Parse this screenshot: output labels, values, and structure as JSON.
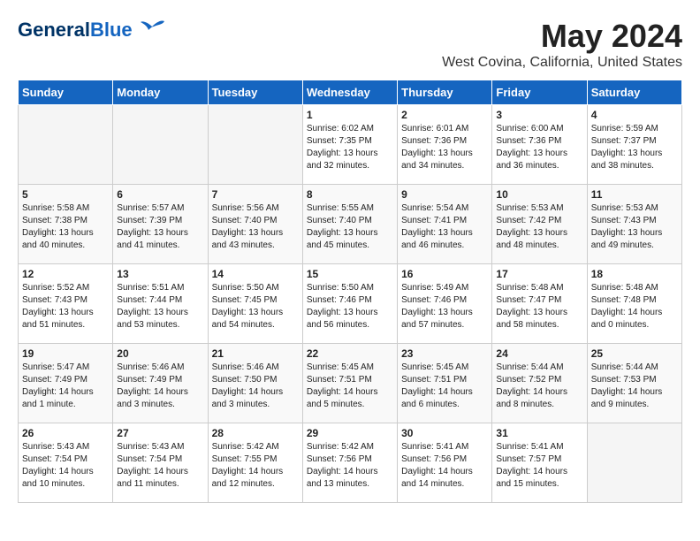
{
  "header": {
    "logo_general": "General",
    "logo_blue": "Blue",
    "title": "May 2024",
    "location": "West Covina, California, United States"
  },
  "weekdays": [
    "Sunday",
    "Monday",
    "Tuesday",
    "Wednesday",
    "Thursday",
    "Friday",
    "Saturday"
  ],
  "weeks": [
    [
      {
        "day": "",
        "empty": true
      },
      {
        "day": "",
        "empty": true
      },
      {
        "day": "",
        "empty": true
      },
      {
        "day": "1",
        "sunrise": "Sunrise: 6:02 AM",
        "sunset": "Sunset: 7:35 PM",
        "daylight": "Daylight: 13 hours and 32 minutes."
      },
      {
        "day": "2",
        "sunrise": "Sunrise: 6:01 AM",
        "sunset": "Sunset: 7:36 PM",
        "daylight": "Daylight: 13 hours and 34 minutes."
      },
      {
        "day": "3",
        "sunrise": "Sunrise: 6:00 AM",
        "sunset": "Sunset: 7:36 PM",
        "daylight": "Daylight: 13 hours and 36 minutes."
      },
      {
        "day": "4",
        "sunrise": "Sunrise: 5:59 AM",
        "sunset": "Sunset: 7:37 PM",
        "daylight": "Daylight: 13 hours and 38 minutes."
      }
    ],
    [
      {
        "day": "5",
        "sunrise": "Sunrise: 5:58 AM",
        "sunset": "Sunset: 7:38 PM",
        "daylight": "Daylight: 13 hours and 40 minutes."
      },
      {
        "day": "6",
        "sunrise": "Sunrise: 5:57 AM",
        "sunset": "Sunset: 7:39 PM",
        "daylight": "Daylight: 13 hours and 41 minutes."
      },
      {
        "day": "7",
        "sunrise": "Sunrise: 5:56 AM",
        "sunset": "Sunset: 7:40 PM",
        "daylight": "Daylight: 13 hours and 43 minutes."
      },
      {
        "day": "8",
        "sunrise": "Sunrise: 5:55 AM",
        "sunset": "Sunset: 7:40 PM",
        "daylight": "Daylight: 13 hours and 45 minutes."
      },
      {
        "day": "9",
        "sunrise": "Sunrise: 5:54 AM",
        "sunset": "Sunset: 7:41 PM",
        "daylight": "Daylight: 13 hours and 46 minutes."
      },
      {
        "day": "10",
        "sunrise": "Sunrise: 5:53 AM",
        "sunset": "Sunset: 7:42 PM",
        "daylight": "Daylight: 13 hours and 48 minutes."
      },
      {
        "day": "11",
        "sunrise": "Sunrise: 5:53 AM",
        "sunset": "Sunset: 7:43 PM",
        "daylight": "Daylight: 13 hours and 49 minutes."
      }
    ],
    [
      {
        "day": "12",
        "sunrise": "Sunrise: 5:52 AM",
        "sunset": "Sunset: 7:43 PM",
        "daylight": "Daylight: 13 hours and 51 minutes."
      },
      {
        "day": "13",
        "sunrise": "Sunrise: 5:51 AM",
        "sunset": "Sunset: 7:44 PM",
        "daylight": "Daylight: 13 hours and 53 minutes."
      },
      {
        "day": "14",
        "sunrise": "Sunrise: 5:50 AM",
        "sunset": "Sunset: 7:45 PM",
        "daylight": "Daylight: 13 hours and 54 minutes."
      },
      {
        "day": "15",
        "sunrise": "Sunrise: 5:50 AM",
        "sunset": "Sunset: 7:46 PM",
        "daylight": "Daylight: 13 hours and 56 minutes."
      },
      {
        "day": "16",
        "sunrise": "Sunrise: 5:49 AM",
        "sunset": "Sunset: 7:46 PM",
        "daylight": "Daylight: 13 hours and 57 minutes."
      },
      {
        "day": "17",
        "sunrise": "Sunrise: 5:48 AM",
        "sunset": "Sunset: 7:47 PM",
        "daylight": "Daylight: 13 hours and 58 minutes."
      },
      {
        "day": "18",
        "sunrise": "Sunrise: 5:48 AM",
        "sunset": "Sunset: 7:48 PM",
        "daylight": "Daylight: 14 hours and 0 minutes."
      }
    ],
    [
      {
        "day": "19",
        "sunrise": "Sunrise: 5:47 AM",
        "sunset": "Sunset: 7:49 PM",
        "daylight": "Daylight: 14 hours and 1 minute."
      },
      {
        "day": "20",
        "sunrise": "Sunrise: 5:46 AM",
        "sunset": "Sunset: 7:49 PM",
        "daylight": "Daylight: 14 hours and 3 minutes."
      },
      {
        "day": "21",
        "sunrise": "Sunrise: 5:46 AM",
        "sunset": "Sunset: 7:50 PM",
        "daylight": "Daylight: 14 hours and 3 minutes."
      },
      {
        "day": "22",
        "sunrise": "Sunrise: 5:45 AM",
        "sunset": "Sunset: 7:51 PM",
        "daylight": "Daylight: 14 hours and 5 minutes."
      },
      {
        "day": "23",
        "sunrise": "Sunrise: 5:45 AM",
        "sunset": "Sunset: 7:51 PM",
        "daylight": "Daylight: 14 hours and 6 minutes."
      },
      {
        "day": "24",
        "sunrise": "Sunrise: 5:44 AM",
        "sunset": "Sunset: 7:52 PM",
        "daylight": "Daylight: 14 hours and 8 minutes."
      },
      {
        "day": "25",
        "sunrise": "Sunrise: 5:44 AM",
        "sunset": "Sunset: 7:53 PM",
        "daylight": "Daylight: 14 hours and 9 minutes."
      }
    ],
    [
      {
        "day": "26",
        "sunrise": "Sunrise: 5:43 AM",
        "sunset": "Sunset: 7:54 PM",
        "daylight": "Daylight: 14 hours and 10 minutes."
      },
      {
        "day": "27",
        "sunrise": "Sunrise: 5:43 AM",
        "sunset": "Sunset: 7:54 PM",
        "daylight": "Daylight: 14 hours and 11 minutes."
      },
      {
        "day": "28",
        "sunrise": "Sunrise: 5:42 AM",
        "sunset": "Sunset: 7:55 PM",
        "daylight": "Daylight: 14 hours and 12 minutes."
      },
      {
        "day": "29",
        "sunrise": "Sunrise: 5:42 AM",
        "sunset": "Sunset: 7:56 PM",
        "daylight": "Daylight: 14 hours and 13 minutes."
      },
      {
        "day": "30",
        "sunrise": "Sunrise: 5:41 AM",
        "sunset": "Sunset: 7:56 PM",
        "daylight": "Daylight: 14 hours and 14 minutes."
      },
      {
        "day": "31",
        "sunrise": "Sunrise: 5:41 AM",
        "sunset": "Sunset: 7:57 PM",
        "daylight": "Daylight: 14 hours and 15 minutes."
      },
      {
        "day": "",
        "empty": true
      }
    ]
  ]
}
